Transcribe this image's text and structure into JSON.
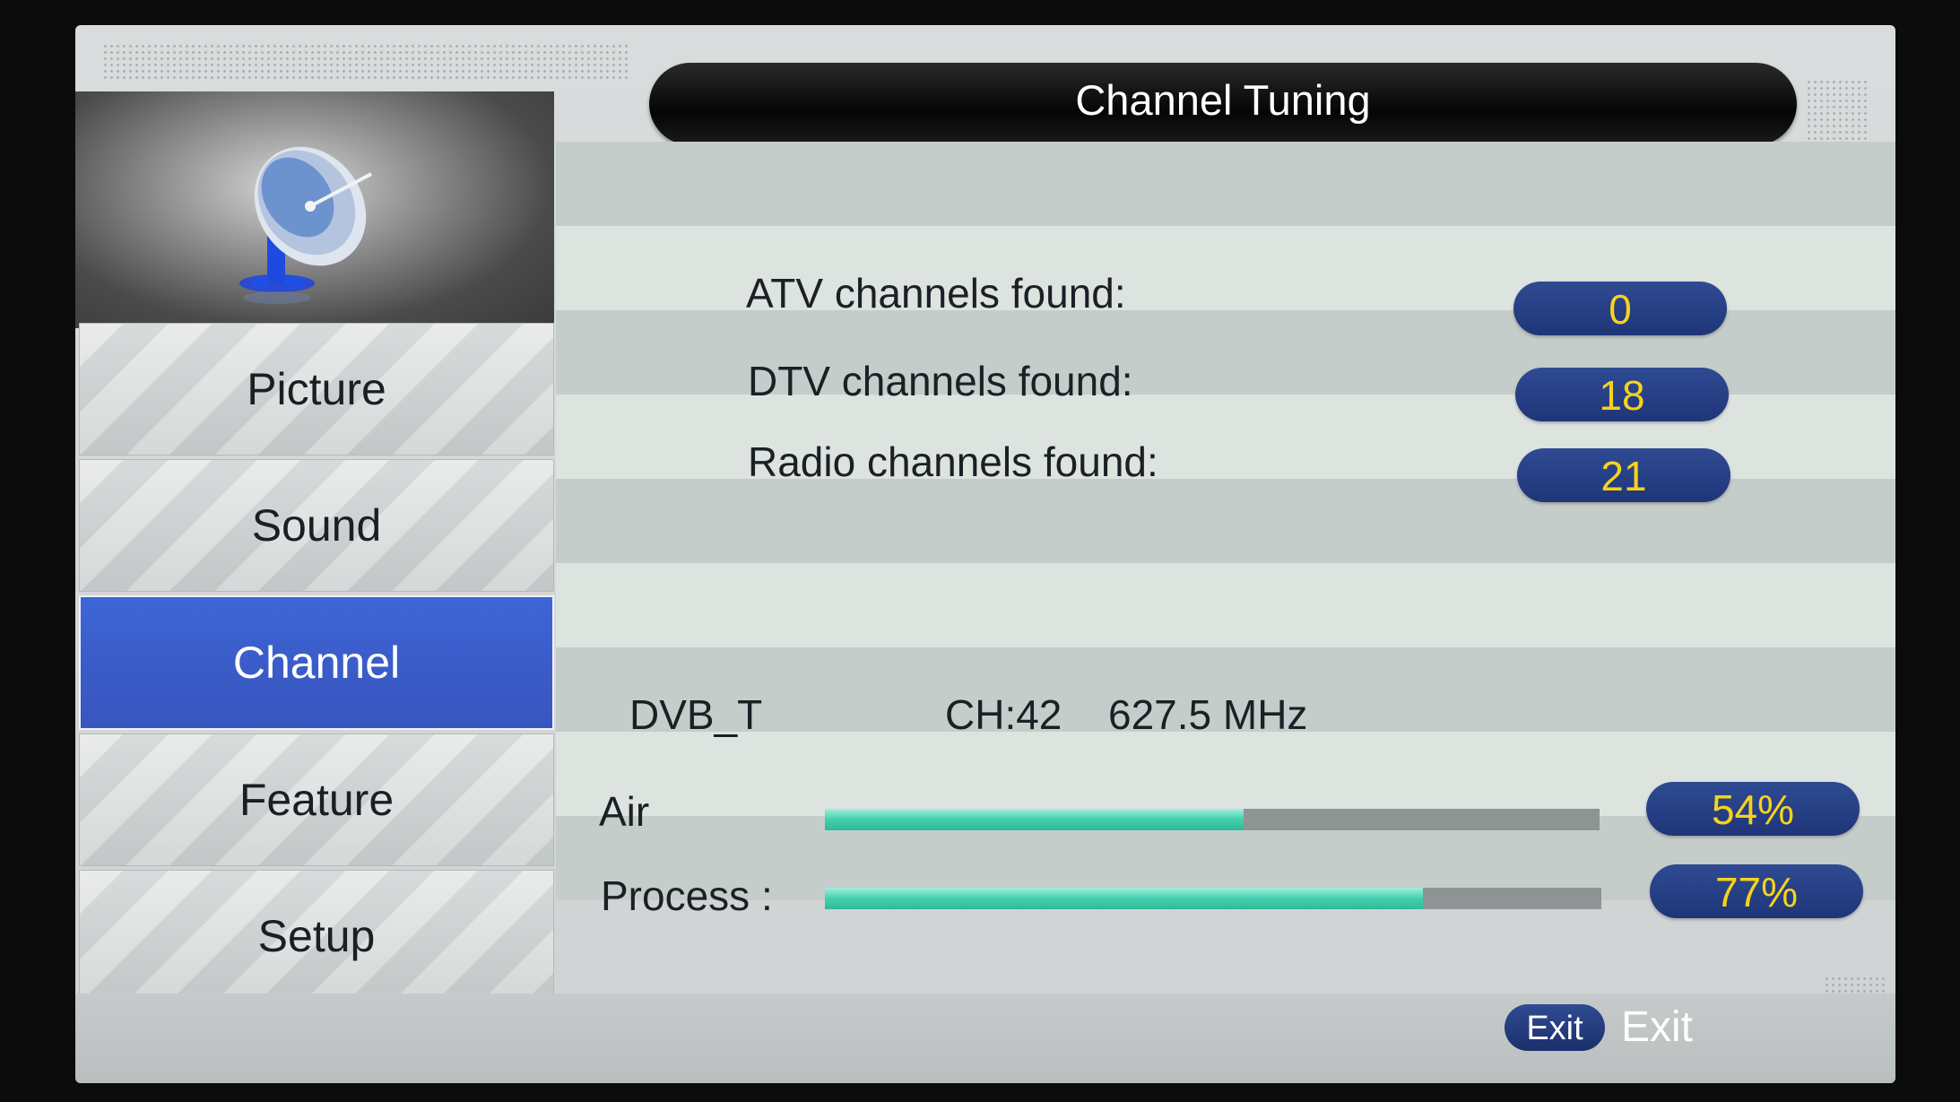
{
  "window": {
    "title": "Channel Tuning"
  },
  "sidebar": {
    "icon": "satellite-dish-icon",
    "items": [
      {
        "label": "Picture",
        "active": false
      },
      {
        "label": "Sound",
        "active": false
      },
      {
        "label": "Channel",
        "active": true
      },
      {
        "label": "Feature",
        "active": false
      },
      {
        "label": "Setup",
        "active": false
      }
    ]
  },
  "results": {
    "atv": {
      "label": "ATV channels found:",
      "value": "0"
    },
    "dtv": {
      "label": "DTV channels found:",
      "value": "18"
    },
    "radio": {
      "label": "Radio channels found:",
      "value": "21"
    }
  },
  "tuning": {
    "standard": "DVB_T",
    "channel": "CH:42",
    "frequency": "627.5 MHz"
  },
  "progress": {
    "air": {
      "label": "Air",
      "percent_text": "54%",
      "fraction": 0.54
    },
    "process": {
      "label": "Process :",
      "percent_text": "77%",
      "fraction": 0.77
    }
  },
  "footer": {
    "exit_key": "Exit",
    "exit_label": "Exit"
  },
  "colors": {
    "accent_blue": "#3b5cc9",
    "value_text": "#f7d21c",
    "pill_blue": "#23397e",
    "bar_fill": "#43cfae"
  }
}
